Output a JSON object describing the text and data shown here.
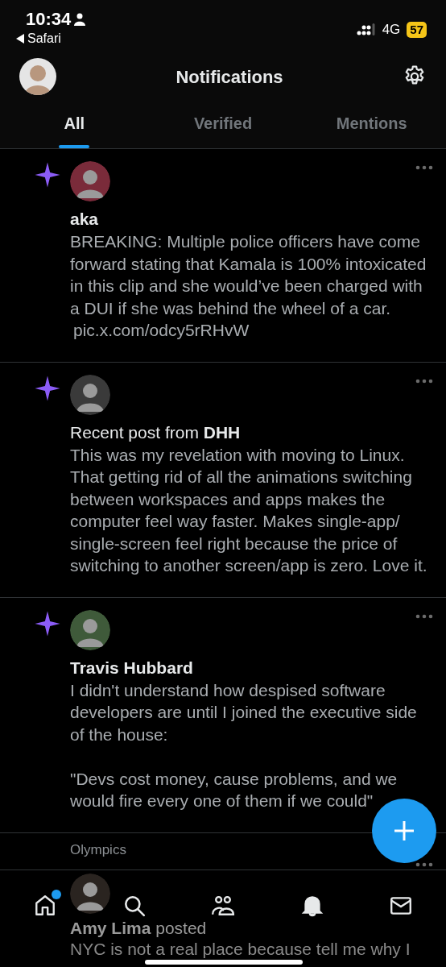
{
  "status_bar": {
    "time": "10:34",
    "back_app": "Safari",
    "network": "4G",
    "battery": "57"
  },
  "header": {
    "title": "Notifications"
  },
  "tabs": [
    {
      "label": "All",
      "selected": true
    },
    {
      "label": "Verified",
      "selected": false
    },
    {
      "label": "Mentions",
      "selected": false
    }
  ],
  "notifications": [
    {
      "kind": "post",
      "actor": "aka",
      "text": "BREAKING: Multiple police officers have come forward stating that Kamala is 100% intoxicated in this clip and she would’ve been charged with a DUI if she was behind the wheel of a car.",
      "link": "pic.x.com/odcy5rRHvW"
    },
    {
      "kind": "post",
      "prefix": "Recent post from",
      "actor": "DHH",
      "text": "This was my revelation with moving to Linux. That getting rid of all the animations switching between workspaces and apps makes the computer feel way faster. Makes single-app/ single-screen feel right because the price of switching to another screen/app is zero. Love it."
    },
    {
      "kind": "post",
      "actor": "Travis Hubbard",
      "text": "I didn't understand how despised software developers are until I joined the executive side of the house:\n\n\"Devs cost money, cause problems, and we would fire every one of them if we could\""
    },
    {
      "kind": "topic",
      "text": "Olympics"
    },
    {
      "kind": "posted",
      "actor": "Amy Lima",
      "action": "posted",
      "text": "NYC is not a real place because tell me why I"
    }
  ],
  "nav": [
    {
      "kind": "home",
      "selected": false,
      "badge": true
    },
    {
      "kind": "search",
      "selected": false,
      "badge": false
    },
    {
      "kind": "communities",
      "selected": false,
      "badge": false
    },
    {
      "kind": "notifications",
      "selected": true,
      "badge": false
    },
    {
      "kind": "messages",
      "selected": false,
      "badge": false
    }
  ]
}
